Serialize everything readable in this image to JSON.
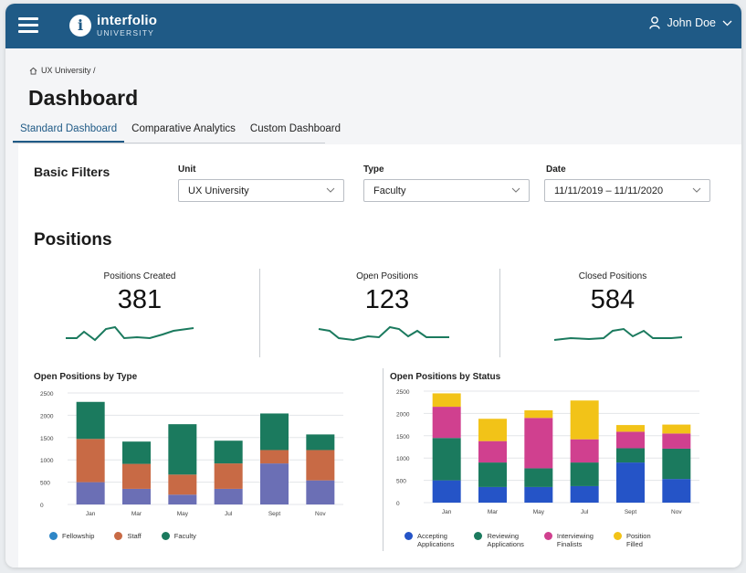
{
  "header": {
    "brand_name": "interfolio",
    "brand_sub": "UNIVERSITY",
    "brand_letter": "i",
    "user_name": "John Doe",
    "bg_color": "#1f5a86"
  },
  "breadcrumb": {
    "text": "UX University /"
  },
  "page_title": "Dashboard",
  "tabs": [
    {
      "label": "Standard Dashboard",
      "active": true
    },
    {
      "label": "Comparative Analytics",
      "active": false
    },
    {
      "label": "Custom Dashboard",
      "active": false
    }
  ],
  "filters": {
    "title": "Basic Filters",
    "unit": {
      "label": "Unit",
      "value": "UX University"
    },
    "type": {
      "label": "Type",
      "value": "Faculty"
    },
    "date": {
      "label": "Date",
      "value": "11/11/2019 – 11/11/2020"
    }
  },
  "positions": {
    "title": "Positions",
    "stats": [
      {
        "label": "Positions Created",
        "value": "381"
      },
      {
        "label": "Open Positions",
        "value": "123"
      },
      {
        "label": "Closed Positions",
        "value": "584"
      }
    ]
  },
  "chart_data": [
    {
      "type": "bar",
      "stacked": true,
      "title": "Open Positions by Type",
      "categories": [
        "Jan",
        "Mar",
        "May",
        "Jul",
        "Sept",
        "Nov"
      ],
      "ylim": [
        0,
        2500
      ],
      "yticks": [
        0,
        500,
        1000,
        1500,
        2000,
        2500
      ],
      "series": [
        {
          "name": "Fellowship",
          "color": "#6b6fb5",
          "values": [
            500,
            350,
            220,
            350,
            920,
            540
          ]
        },
        {
          "name": "Staff",
          "color": "#c86a45",
          "values": [
            970,
            560,
            450,
            570,
            300,
            680
          ]
        },
        {
          "name": "Faculty",
          "color": "#1b7a5e",
          "values": [
            830,
            500,
            1130,
            510,
            820,
            350
          ]
        }
      ],
      "legend": [
        "Fellowship",
        "Staff",
        "Faculty"
      ],
      "legend_colors": [
        "#2e86c7",
        "#c86a45",
        "#1b7a5e"
      ]
    },
    {
      "type": "bar",
      "stacked": true,
      "title": "Open Positions by Status",
      "categories": [
        "Jan",
        "Mar",
        "May",
        "Jul",
        "Sept",
        "Nov"
      ],
      "ylim": [
        0,
        2500
      ],
      "yticks": [
        0,
        500,
        1000,
        1500,
        2000,
        2500
      ],
      "series": [
        {
          "name": "Accepting Applications",
          "color": "#2554c7",
          "values": [
            500,
            350,
            350,
            370,
            900,
            530
          ]
        },
        {
          "name": "Reviewing Applications",
          "color": "#1b7a5e",
          "values": [
            950,
            550,
            420,
            530,
            320,
            680
          ]
        },
        {
          "name": "Interviewing Finalists",
          "color": "#d0408f",
          "values": [
            700,
            480,
            1130,
            520,
            370,
            340
          ]
        },
        {
          "name": "Position Filled",
          "color": "#f2c318",
          "values": [
            300,
            500,
            170,
            870,
            150,
            200
          ]
        }
      ],
      "legend": [
        {
          "line1": "Accepting",
          "line2": "Applications"
        },
        {
          "line1": "Reviewing",
          "line2": "Applications"
        },
        {
          "line1": "Interviewing",
          "line2": "Finalists"
        },
        {
          "line1": "Position",
          "line2": "Filled"
        }
      ]
    }
  ]
}
